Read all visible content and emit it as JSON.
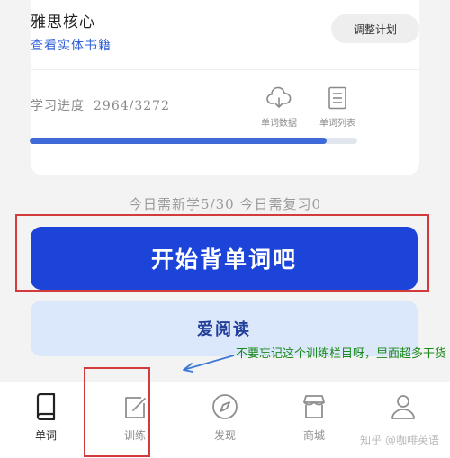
{
  "book": {
    "title": "雅思核心",
    "link": "查看实体书籍",
    "adjust_label": "调整计划"
  },
  "progress": {
    "label": "学习进度",
    "value": "2964/3272",
    "learned": 2964,
    "total": 3272,
    "fraction": 0.906
  },
  "tools": {
    "data_label": "单词数据",
    "data_icon": "cloud-icon",
    "list_label": "单词列表",
    "list_icon": "list-document-icon"
  },
  "today": "今日需新学5/30  今日需复习0",
  "start_label": "开始背单词吧",
  "read_label": "爱阅读",
  "nav": {
    "items": [
      {
        "label": "单词",
        "icon": "book-icon",
        "active": true
      },
      {
        "label": "训练",
        "icon": "edit-icon",
        "active": false
      },
      {
        "label": "发现",
        "icon": "compass-icon",
        "active": false
      },
      {
        "label": "商城",
        "icon": "shop-icon",
        "active": false
      },
      {
        "label": "我的",
        "icon": "user-icon",
        "active": false
      }
    ]
  },
  "annotation": "不要忘记这个训练栏目呀，里面超多干货",
  "watermark": "知乎 @咖啡英语",
  "colors": {
    "primary": "#1d44d8",
    "link": "#2f5fd8",
    "progress": "#3f6ad8",
    "highlight": "#d23b3b",
    "note": "#1b8a1b"
  }
}
